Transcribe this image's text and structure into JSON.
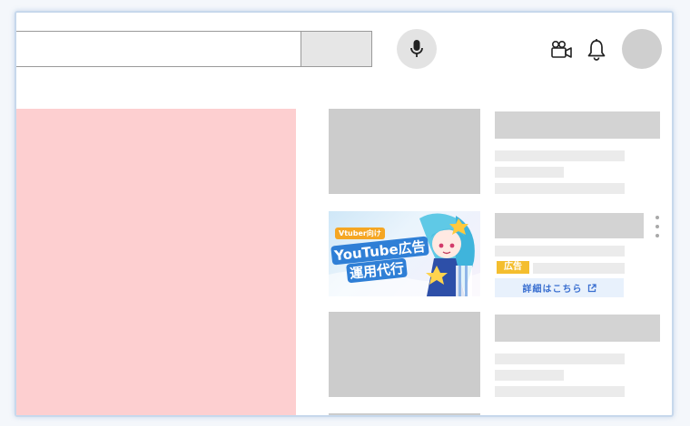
{
  "header": {
    "search_placeholder": "",
    "search_button_label": "",
    "mic_icon": "microphone-icon",
    "create_icon": "video-camera-plus-icon",
    "notifications_icon": "bell-icon"
  },
  "player": {
    "color": "#fdcfd0"
  },
  "ad": {
    "thumbnail_text": {
      "tag": "Vtuber向け",
      "line1": "YouTube広告",
      "line2": "運用代行"
    },
    "badge": "広告",
    "badge_color": "#f4be2f",
    "link_label": "詳細はこちら",
    "link_icon": "external-link-icon",
    "link_color": "#3a6fd0"
  },
  "colors": {
    "placeholder_dark": "#cccccc",
    "placeholder_light": "#ebebeb",
    "frame_border": "#c7d8ec"
  }
}
